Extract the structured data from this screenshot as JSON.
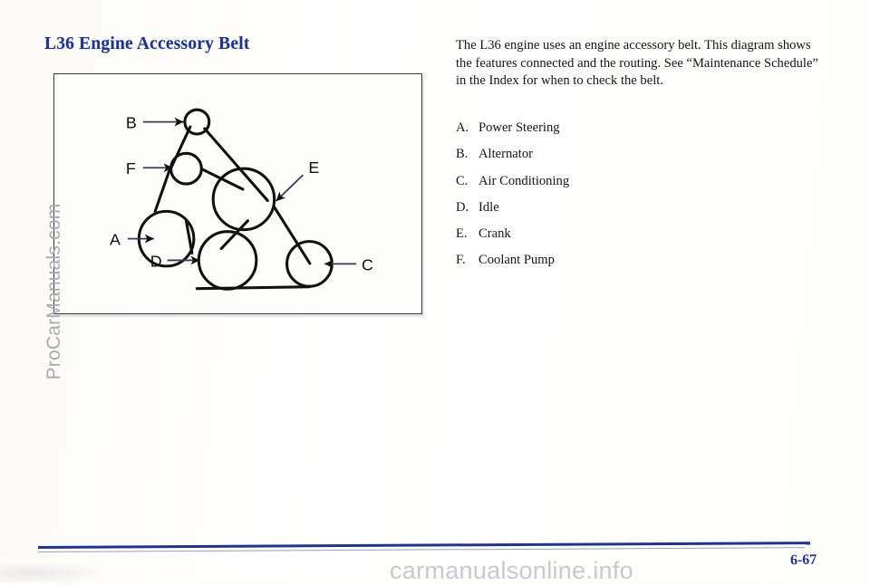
{
  "document": {
    "title": "L36 Engine Accessory Belt",
    "page_number": "6-67"
  },
  "body": {
    "paragraph": "The L36 engine uses an engine accessory belt. This diagram shows the features connected and the routing. See “Maintenance Schedule” in the Index for when to check the belt."
  },
  "legend": {
    "items": [
      {
        "letter": "A.",
        "label": "Power Steering"
      },
      {
        "letter": "B.",
        "label": "Alternator"
      },
      {
        "letter": "C.",
        "label": "Air Conditioning"
      },
      {
        "letter": "D.",
        "label": "Idle"
      },
      {
        "letter": "E.",
        "label": "Crank"
      },
      {
        "letter": "F.",
        "label": "Coolant Pump"
      }
    ]
  },
  "figure": {
    "callouts": {
      "a": "A",
      "b": "B",
      "c": "C",
      "d": "D",
      "e": "E",
      "f": "F"
    }
  },
  "watermarks": {
    "left": "ProCarManuals.com",
    "bottom": "carmanualsonline.info"
  },
  "colors": {
    "accent_blue": "#21348c",
    "ink": "#15151a",
    "page_background": "#fdfdfa",
    "rule_thin": "#9aa0b5",
    "watermark_gray": "#c9c9d0"
  }
}
